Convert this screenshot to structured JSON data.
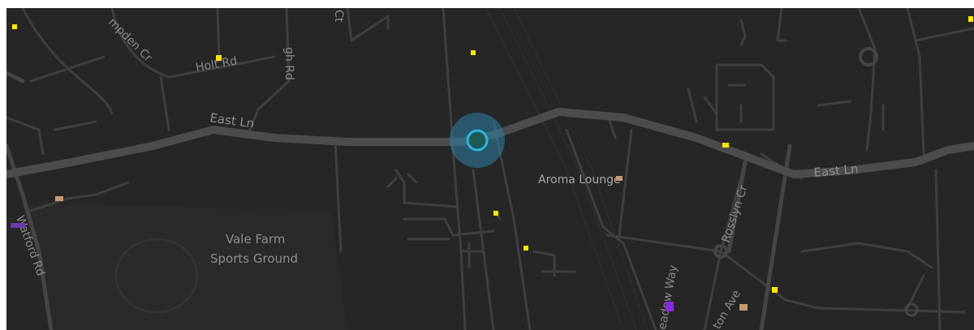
{
  "map": {
    "colors": {
      "background": "#262626",
      "road_minor": "#3f3f3f",
      "road_major": "#4c4c4c",
      "label": "#8e8e8e",
      "location_dot": "#29b6e6",
      "poi_yellow": "#ffe600",
      "poi_tan": "#c89a70",
      "poi_purple": "#8a2be2"
    },
    "road_labels": {
      "east_ln_west": "East Ln",
      "east_ln_east": "East Ln",
      "holt_rd": "Holt Rd",
      "hampden_cr": "mpden Cr",
      "watford_rd": "Watford Rd",
      "rosslyn_cr": "Rosslyn Cr",
      "meadow_way": "eadow Way",
      "ton_ave": "ton Ave",
      "top_rd": "gh Rd",
      "top_ct": "Ct"
    },
    "place_labels": {
      "sports_ground_line1": "Vale Farm",
      "sports_ground_line2": "Sports Ground",
      "aroma_lounge": "Aroma Lounge"
    },
    "marker": {
      "type": "current-location"
    }
  }
}
